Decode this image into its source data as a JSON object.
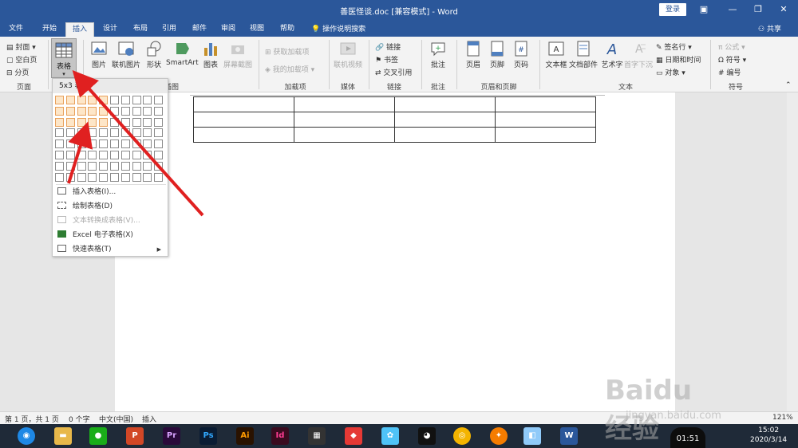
{
  "titlebar": {
    "title": "善医怪谈.doc [兼容模式] - Word",
    "login": "登录"
  },
  "tabs": [
    {
      "label": "文件"
    },
    {
      "label": "开始"
    },
    {
      "label": "插入"
    },
    {
      "label": "设计"
    },
    {
      "label": "布局"
    },
    {
      "label": "引用"
    },
    {
      "label": "邮件"
    },
    {
      "label": "审阅"
    },
    {
      "label": "视图"
    },
    {
      "label": "帮助"
    }
  ],
  "tellme": "操作说明搜索",
  "share": "共享",
  "ribbon": {
    "pages": {
      "cover": "封面",
      "blank": "空白页",
      "break": "分页",
      "label": "页面"
    },
    "table": {
      "label": "表格"
    },
    "illustrations": {
      "picture": "图片",
      "online_picture": "联机图片",
      "shapes": "形状",
      "smartart": "SmartArt",
      "chart": "图表",
      "screenshot": "屏幕截图",
      "label": "插图"
    },
    "addins": {
      "get": "获取加载项",
      "mine": "我的加载项",
      "label": "加载项"
    },
    "media": {
      "online_video": "联机视频",
      "label": "媒体"
    },
    "links": {
      "link": "链接",
      "bookmark": "书签",
      "crossref": "交叉引用",
      "label": "链接"
    },
    "comments": {
      "comment": "批注",
      "label": "批注"
    },
    "header_footer": {
      "header": "页眉",
      "footer": "页脚",
      "page_number": "页码",
      "label": "页眉和页脚"
    },
    "text": {
      "textbox": "文本框",
      "quickparts": "文档部件",
      "wordart": "艺术字",
      "dropcap": "首字下沉",
      "signature": "签名行",
      "datetime": "日期和时间",
      "object": "对象",
      "label": "文本"
    },
    "symbols": {
      "equation": "公式",
      "symbol": "符号",
      "number": "编号",
      "label": "符号"
    }
  },
  "dropdown": {
    "header": "5x3 表格",
    "grid_cols": 10,
    "grid_rows": 8,
    "selected_cols": 5,
    "selected_rows": 3,
    "items": [
      {
        "label": "插入表格(I)...",
        "disabled": false
      },
      {
        "label": "绘制表格(D)",
        "disabled": false
      },
      {
        "label": "文本转换成表格(V)...",
        "disabled": true
      },
      {
        "label": "Excel 电子表格(X)",
        "disabled": false
      },
      {
        "label": "快速表格(T)",
        "disabled": false
      }
    ]
  },
  "document": {
    "table_rows": 3,
    "table_cols": 4
  },
  "statusbar": {
    "page": "第 1 页，共 1 页",
    "words": "0 个字",
    "lang": "中文(中国)",
    "mode": "插入",
    "zoom": "121%"
  },
  "taskbar": {
    "time": "15:02",
    "date": "2020/3/14",
    "badge": "01:51"
  },
  "watermark": {
    "text": "Baidu经验",
    "sub": "jingyan.baidu.com"
  },
  "colors": {
    "accent": "#2b579a",
    "selection_fill": "#fde6c8",
    "selection_border": "#e8a05a",
    "arrow": "#e02020"
  }
}
